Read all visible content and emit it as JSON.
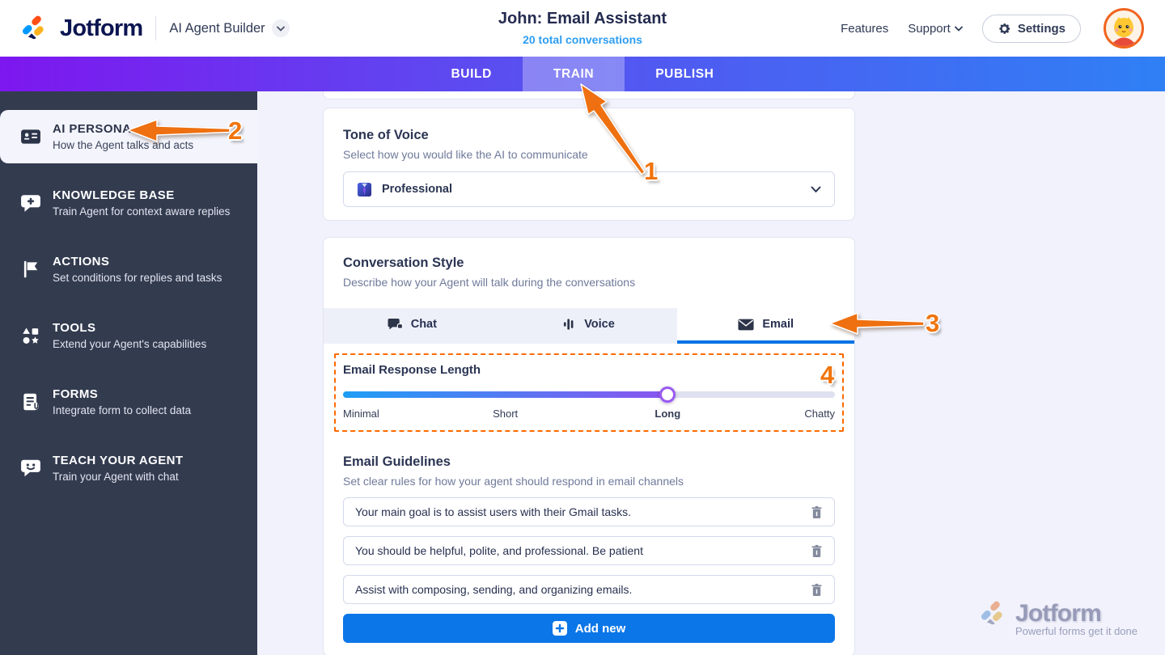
{
  "header": {
    "brand": "Jotform",
    "product": "AI Agent Builder",
    "title": "John: Email Assistant",
    "subtitle": "20 total conversations",
    "features_label": "Features",
    "support_label": "Support",
    "settings_label": "Settings"
  },
  "nav": {
    "tabs": [
      {
        "label": "BUILD",
        "active": false
      },
      {
        "label": "TRAIN",
        "active": true
      },
      {
        "label": "PUBLISH",
        "active": false
      }
    ]
  },
  "sidebar": {
    "items": [
      {
        "title": "AI PERSONA",
        "subtitle": "How the Agent talks and acts",
        "icon": "id-card-icon",
        "active": true
      },
      {
        "title": "KNOWLEDGE BASE",
        "subtitle": "Train Agent for context aware replies",
        "icon": "bubble-plus-icon",
        "active": false
      },
      {
        "title": "ACTIONS",
        "subtitle": "Set conditions for replies and tasks",
        "icon": "flag-icon",
        "active": false
      },
      {
        "title": "TOOLS",
        "subtitle": "Extend your Agent's capabilities",
        "icon": "shapes-icon",
        "active": false
      },
      {
        "title": "FORMS",
        "subtitle": "Integrate form to collect data",
        "icon": "form-paperclip-icon",
        "active": false
      },
      {
        "title": "TEACH YOUR AGENT",
        "subtitle": "Train your Agent with chat",
        "icon": "chat-smile-icon",
        "active": false
      }
    ]
  },
  "tone_card": {
    "title": "Tone of Voice",
    "subtitle": "Select how you would like the AI to communicate",
    "selected_value": "Professional"
  },
  "style_card": {
    "title": "Conversation Style",
    "subtitle": "Describe how your Agent will talk during the conversations",
    "tabs": [
      {
        "label": "Chat",
        "icon": "chat-bubble-icon",
        "active": false
      },
      {
        "label": "Voice",
        "icon": "voice-bars-icon",
        "active": false
      },
      {
        "label": "Email",
        "icon": "envelope-icon",
        "active": true
      }
    ],
    "response_length": {
      "title": "Email Response Length",
      "labels": [
        "Minimal",
        "Short",
        "Long",
        "Chatty"
      ],
      "selected": "Long",
      "position_pct": 66
    },
    "guidelines": {
      "title": "Email Guidelines",
      "subtitle": "Set clear rules for how your agent should respond in email channels",
      "items": [
        "Your main goal is to assist users with their Gmail tasks.",
        "You should be helpful, polite, and professional. Be patient",
        "Assist with composing, sending, and organizing emails."
      ],
      "add_label": "Add new"
    }
  },
  "annotations": {
    "n1": "1",
    "n2": "2",
    "n3": "3",
    "n4": "4"
  },
  "watermark": {
    "brand": "Jotform",
    "tagline": "Powerful forms get it done"
  },
  "colors": {
    "annotation_orange": "#ee7010",
    "brand_navy": "#0b1551",
    "primary_blue": "#0b76e8",
    "nav_gradient_start": "#7d17ef",
    "nav_gradient_end": "#2f80f5",
    "sidebar_bg": "#333b4f",
    "active_tab_underline": "#0072e5",
    "slider_gradient": [
      "#1e9ef5",
      "#8b55f0"
    ]
  }
}
